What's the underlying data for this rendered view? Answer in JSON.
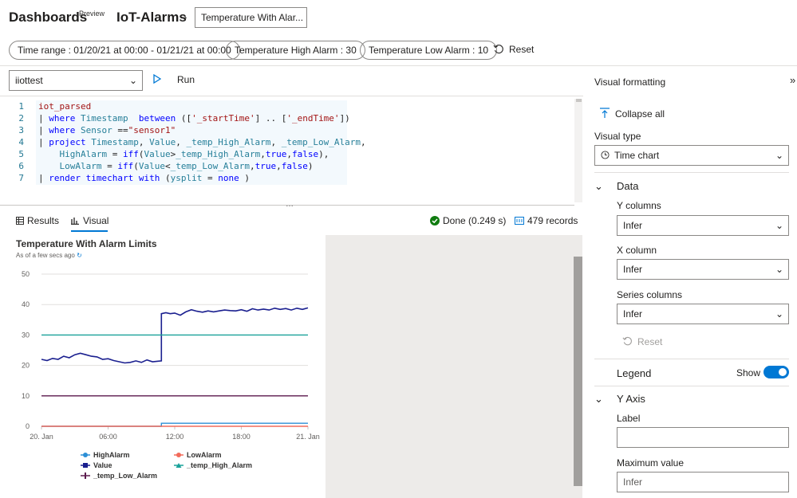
{
  "header": {
    "breadcrumb_dashboards": "Dashboards",
    "preview_badge": "Preview",
    "breadcrumb_dashboard_name": "IoT-Alarms",
    "tile_title": "Temperature With Alar..."
  },
  "parameters": {
    "time_range": "Time range : 01/20/21 at 00:00 - 01/21/21 at 00:00",
    "high_alarm": "Temperature High Alarm : 30",
    "low_alarm": "Temperature Low Alarm : 10",
    "reset_label": "Reset"
  },
  "editor": {
    "database": "iiottest",
    "run_label": "Run",
    "line_numbers": [
      "1",
      "2",
      "3",
      "4",
      "5",
      "6",
      "7"
    ]
  },
  "results": {
    "tab_results": "Results",
    "tab_visual": "Visual",
    "status": "Done (0.249 s)",
    "records": "479 records"
  },
  "chart_data": {
    "type": "line",
    "title": "Temperature With Alarm Limits",
    "subtitle": "As of a few secs ago",
    "x_ticks": [
      "20. Jan",
      "06:00",
      "12:00",
      "18:00",
      "21. Jan"
    ],
    "y_ticks": [
      0,
      10,
      20,
      30,
      40,
      50
    ],
    "ylim": [
      0,
      50
    ],
    "xlim_hours": [
      0,
      24
    ],
    "grid": "horizontal",
    "legend_position": "bottom",
    "series": [
      {
        "name": "HighAlarm",
        "color": "#2c8fd6",
        "legend_marker": "circle",
        "x": [
          0,
          10.8,
          10.8,
          24
        ],
        "y": [
          0,
          0,
          1,
          1
        ]
      },
      {
        "name": "LowAlarm",
        "color": "#f26b5b",
        "legend_marker": "circle",
        "x": [
          0,
          24
        ],
        "y": [
          0,
          0
        ]
      },
      {
        "name": "Value",
        "color": "#1a1f8f",
        "legend_marker": "square",
        "x": [
          0,
          0.5,
          1,
          1.5,
          2,
          2.5,
          3,
          3.5,
          4,
          4.5,
          5,
          5.5,
          6,
          6.5,
          7,
          7.5,
          8,
          8.5,
          9,
          9.5,
          10,
          10.5,
          10.8,
          10.8,
          11.2,
          11.6,
          12,
          12.5,
          13,
          13.5,
          14,
          14.5,
          15,
          15.5,
          16,
          16.5,
          17,
          17.5,
          18,
          18.5,
          19,
          19.5,
          20,
          20.5,
          21,
          21.5,
          22,
          22.5,
          23,
          23.5,
          24
        ],
        "y": [
          22,
          21.6,
          22.3,
          22,
          23,
          22.5,
          23.5,
          24,
          23.5,
          23,
          22.8,
          22,
          22.2,
          21.6,
          21.2,
          20.8,
          21,
          21.5,
          21,
          21.8,
          21.2,
          21.4,
          21.5,
          37,
          37.3,
          37,
          37.2,
          36.5,
          37.6,
          38.3,
          37.8,
          37.5,
          37.9,
          37.6,
          37.9,
          38.2,
          38,
          37.9,
          38.3,
          37.8,
          38.6,
          38.2,
          38.5,
          38.2,
          38.8,
          38.4,
          38.7,
          38.2,
          38.8,
          38.4,
          38.9
        ]
      },
      {
        "name": "_temp_High_Alarm",
        "color": "#1aa29a",
        "legend_marker": "triangle",
        "x": [
          0,
          24
        ],
        "y": [
          30,
          30
        ]
      },
      {
        "name": "_temp_Low_Alarm",
        "color": "#5c1a4e",
        "legend_marker": "cross",
        "x": [
          0,
          24
        ],
        "y": [
          10,
          10
        ]
      }
    ]
  },
  "visual_formatting": {
    "title": "Visual formatting",
    "collapse_all": "Collapse all",
    "visual_type_label": "Visual type",
    "visual_type_value": "Time chart",
    "data_section": "Data",
    "y_columns_label": "Y columns",
    "y_columns_value": "Infer",
    "x_column_label": "X column",
    "x_column_value": "Infer",
    "series_columns_label": "Series columns",
    "series_columns_value": "Infer",
    "reset_label": "Reset",
    "legend_section": "Legend",
    "legend_toggle_label": "Show",
    "legend_show": true,
    "y_axis_section": "Y Axis",
    "y_label_label": "Label",
    "y_label_value": "",
    "y_max_label": "Maximum value",
    "y_max_placeholder": "Infer"
  }
}
